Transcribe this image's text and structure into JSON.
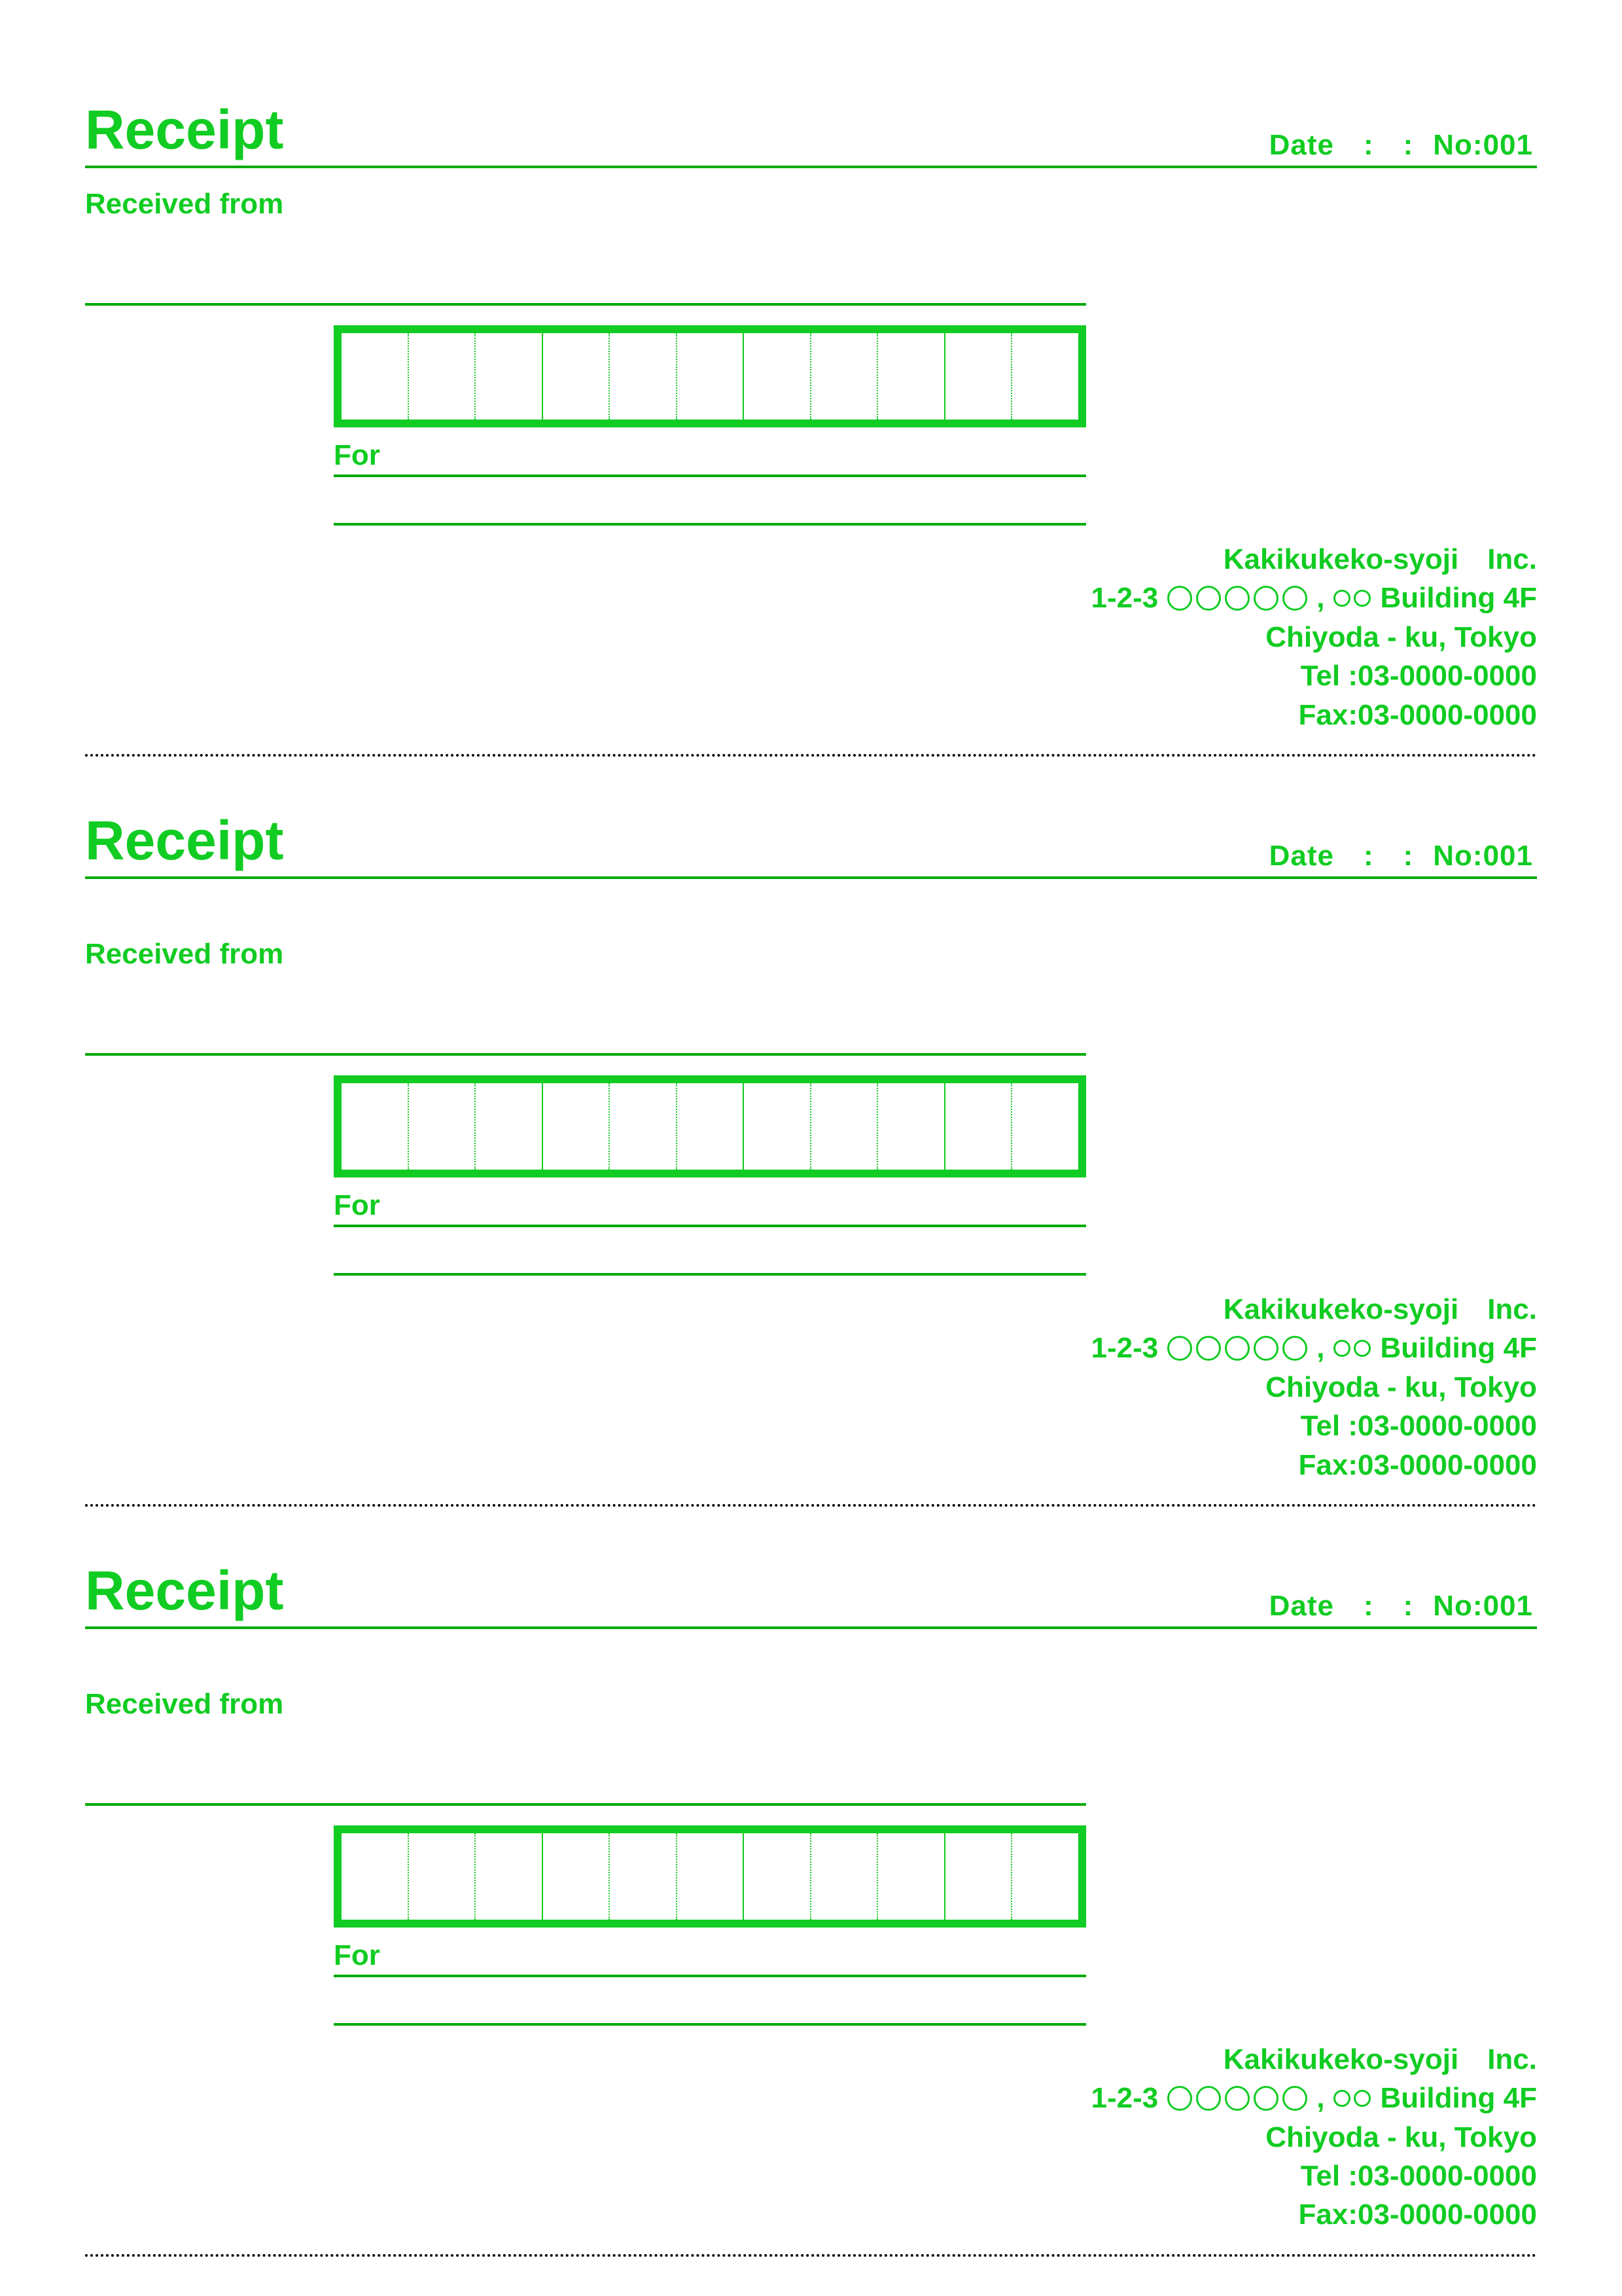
{
  "receipts": [
    {
      "title": "Receipt",
      "date_label": "Date",
      "no_label": "No:",
      "no_value": "001",
      "received_from_label": "Received from",
      "for_label": "For",
      "issuer": {
        "company": "Kakikukeko-syoji Inc.",
        "address1_prefix": "1-2-3",
        "building": "Building 4F",
        "address2": "Chiyoda - ku, Tokyo",
        "tel": "Tel :03-0000-0000",
        "fax": "Fax:03-0000-0000"
      }
    },
    {
      "title": "Receipt",
      "date_label": "Date",
      "no_label": "No:",
      "no_value": "001",
      "received_from_label": "Received from",
      "for_label": "For",
      "issuer": {
        "company": "Kakikukeko-syoji Inc.",
        "address1_prefix": "1-2-3",
        "building": "Building 4F",
        "address2": "Chiyoda - ku, Tokyo",
        "tel": "Tel :03-0000-0000",
        "fax": "Fax:03-0000-0000"
      }
    },
    {
      "title": "Receipt",
      "date_label": "Date",
      "no_label": "No:",
      "no_value": "001",
      "received_from_label": "Received from",
      "for_label": "For",
      "issuer": {
        "company": "Kakikukeko-syoji Inc.",
        "address1_prefix": "1-2-3",
        "building": "Building 4F",
        "address2": "Chiyoda - ku, Tokyo",
        "tel": "Tel :03-0000-0000",
        "fax": "Fax:03-0000-0000"
      }
    }
  ]
}
